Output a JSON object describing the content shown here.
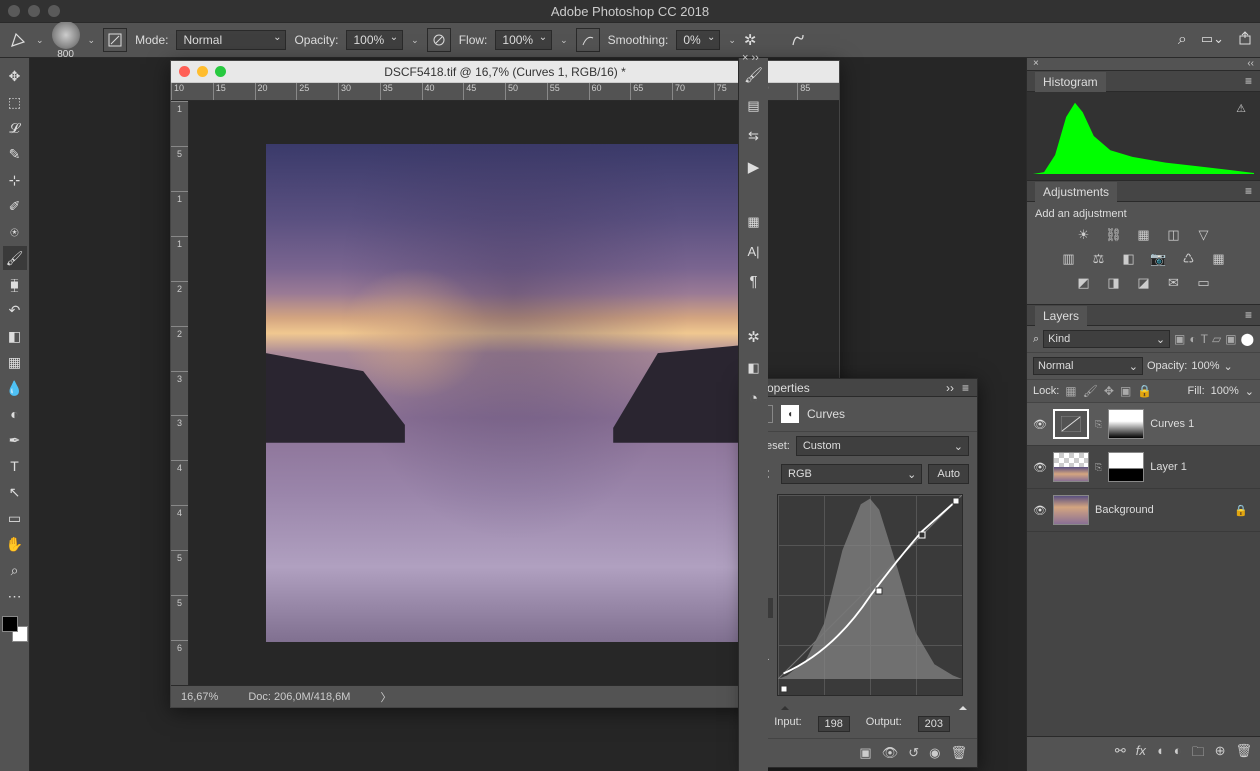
{
  "app": {
    "title": "Adobe Photoshop CC 2018"
  },
  "doc": {
    "title": "DSCF5418.tif @ 16,7% (Curves 1, RGB/16) *",
    "zoom": "16,67%",
    "size": "Doc: 206,0M/418,6M"
  },
  "optionsBar": {
    "brushSize": "800",
    "modeLabel": "Mode:",
    "mode": "Normal",
    "opacityLabel": "Opacity:",
    "opacity": "100%",
    "flowLabel": "Flow:",
    "flow": "100%",
    "smoothingLabel": "Smoothing:",
    "smoothing": "0%"
  },
  "ruler": {
    "h": [
      "10",
      "15",
      "20",
      "25",
      "30",
      "35",
      "40",
      "45",
      "50",
      "55",
      "60",
      "65",
      "70",
      "75",
      "80",
      "85"
    ],
    "v": [
      "1",
      "5",
      "1",
      "1",
      "2",
      "2",
      "3",
      "3",
      "4",
      "4",
      "5",
      "5",
      "6"
    ]
  },
  "properties": {
    "title": "Properties",
    "type": "Curves",
    "presetLabel": "Preset:",
    "preset": "Custom",
    "channel": "RGB",
    "auto": "Auto",
    "inputLabel": "Input:",
    "input": "198",
    "outputLabel": "Output:",
    "output": "203"
  },
  "histogram": {
    "title": "Histogram"
  },
  "adjustments": {
    "title": "Adjustments",
    "label": "Add an adjustment"
  },
  "layers": {
    "title": "Layers",
    "kindLabel": "Kind",
    "blendMode": "Normal",
    "opacityLabel": "Opacity:",
    "opacity": "100%",
    "lockLabel": "Lock:",
    "fillLabel": "Fill:",
    "fill": "100%",
    "items": [
      {
        "name": "Curves 1",
        "visible": true,
        "selected": true,
        "type": "curves"
      },
      {
        "name": "Layer 1",
        "visible": true,
        "selected": false,
        "type": "layer"
      },
      {
        "name": "Background",
        "visible": true,
        "selected": false,
        "type": "bg",
        "locked": true
      }
    ]
  },
  "search": "⌕"
}
